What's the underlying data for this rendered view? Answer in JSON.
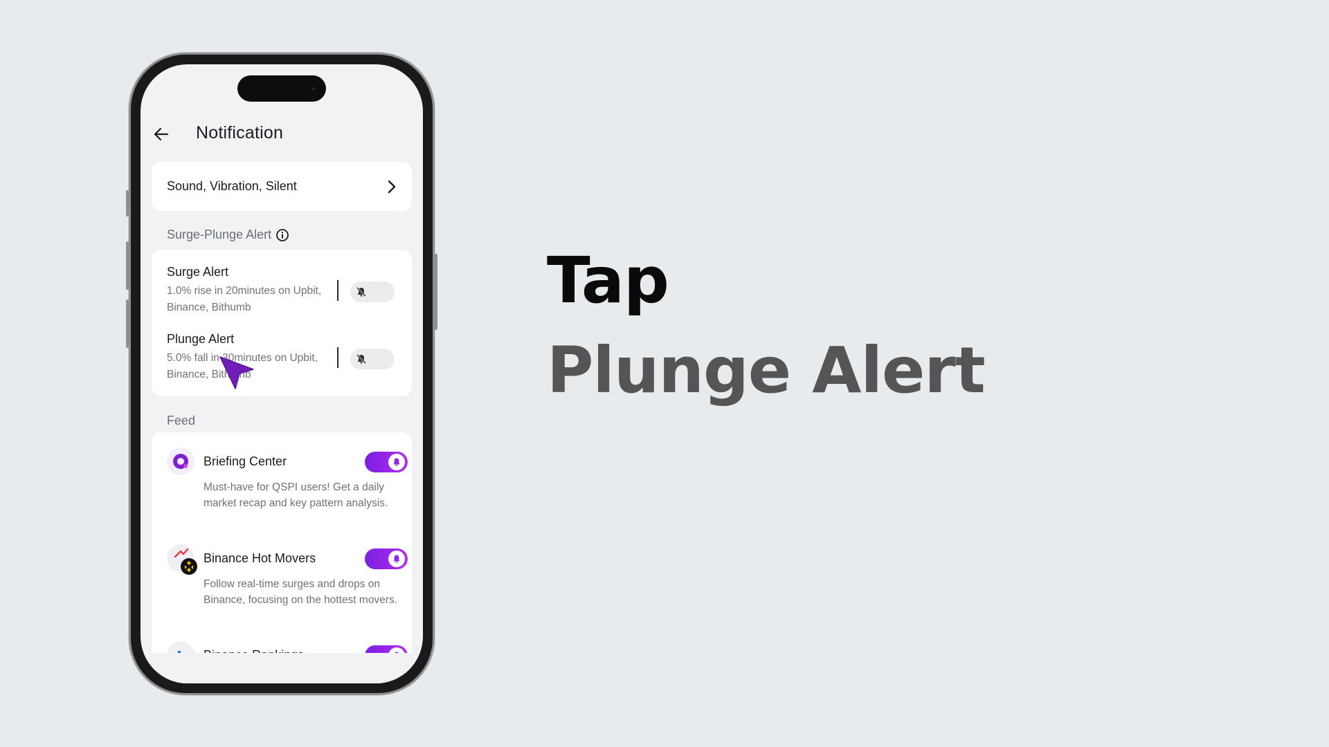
{
  "header": {
    "title": "Notification"
  },
  "sound_settings": {
    "label": "Sound, Vibration, Silent"
  },
  "surge_plunge": {
    "section_title": "Surge-Plunge Alert",
    "items": [
      {
        "title": "Surge Alert",
        "description": "1.0% rise in 20minutes on Upbit, Binance, Bithumb",
        "enabled": false
      },
      {
        "title": "Plunge Alert",
        "description": "5.0% fall in 30minutes on Upbit, Binance, Bithumb",
        "enabled": false
      }
    ]
  },
  "feed": {
    "section_title": "Feed",
    "items": [
      {
        "title": "Briefing Center",
        "description": "Must-have for QSPI users! Get a daily market recap and key pattern analysis.",
        "enabled": true
      },
      {
        "title": "Binance Hot Movers",
        "description": "Follow real-time surges and drops on Binance, focusing on the hottest movers.",
        "enabled": true
      },
      {
        "title": "Binance Rankings",
        "enabled": true
      }
    ]
  },
  "caption": {
    "line1": "Tap",
    "line2": "Plunge Alert"
  },
  "colors": {
    "accent": "#8e24e6",
    "background": "#e8ebee",
    "caption_secondary": "#555555"
  }
}
